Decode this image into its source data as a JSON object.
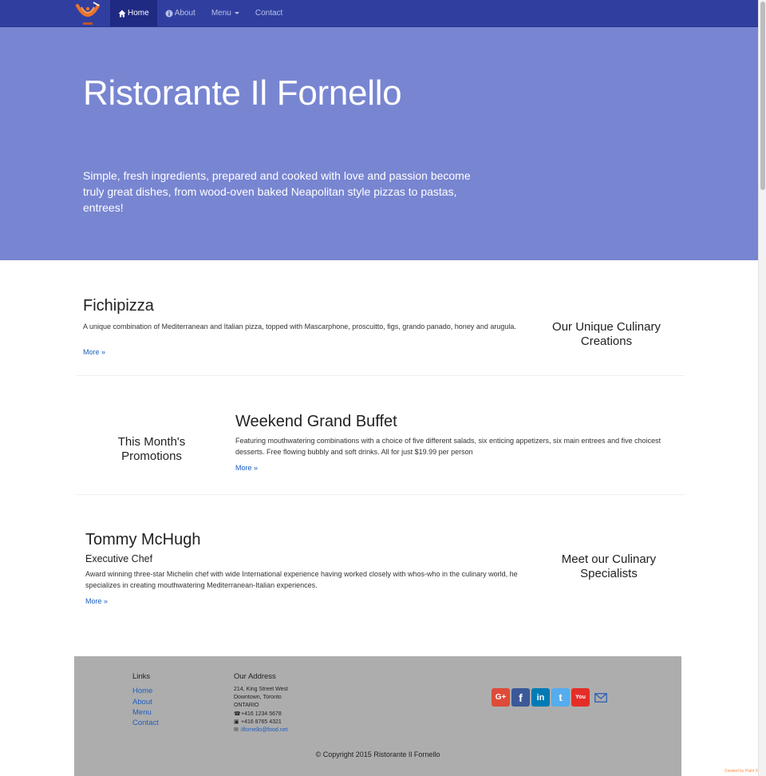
{
  "nav": {
    "items": [
      {
        "label": "Home",
        "active": true
      },
      {
        "label": "About"
      },
      {
        "label": "Menu"
      },
      {
        "label": "Contact"
      }
    ]
  },
  "hero": {
    "title": "Ristorante Il Fornello",
    "tagline": "Simple, fresh ingredients, prepared and cooked with love and passion become truly great dishes, from wood-oven baked Neapolitan style pizzas to pastas, entrees!"
  },
  "sections": [
    {
      "title": "Fichipizza",
      "text": "A unique combination of Mediterranean and Italian pizza, topped with Mascarphone, proscuitto, figs, grando panado, honey and arugula.",
      "more": "More »",
      "side": "Our Unique Culinary Creations"
    },
    {
      "title": "Weekend Grand Buffet",
      "text": "Featuring mouthwatering combinations with a choice of five different salads, six enticing appetizers, six main entrees and five choicest desserts. Free flowing bubbly and soft drinks. All for just $19.99 per person",
      "more": "More »",
      "side": "This Month's Promotions"
    },
    {
      "title": "Tommy McHugh",
      "subtitle": "Executive Chef",
      "text": "Award winning three-star Michelin chef with wide International experience having worked closely with whos-who in the culinary world, he specializes in creating mouthwatering Mediterranean-Italian experiences.",
      "more": "More »",
      "side": "Meet our Culinary Specialists"
    }
  ],
  "footer": {
    "links_heading": "Links",
    "links": [
      "Home",
      "About",
      "Menu",
      "Contact"
    ],
    "address_heading": "Our Address",
    "address_lines": [
      "214, King Street West",
      "Downtown, Toronto",
      "ONTARIO"
    ],
    "phone": "+416 1234 5678",
    "fax": "+416 8765 4321",
    "email": "ilfornello@food.net",
    "social": [
      {
        "icon": "google-plus-icon",
        "glyph": "G+",
        "color": "#dd4b39"
      },
      {
        "icon": "facebook-icon",
        "glyph": "f",
        "color": "#3b5998"
      },
      {
        "icon": "linkedin-icon",
        "glyph": "in",
        "color": "#007bb6"
      },
      {
        "icon": "twitter-icon",
        "glyph": "t",
        "color": "#55acee"
      },
      {
        "icon": "youtube-icon",
        "glyph": "You",
        "color": "#e52d27"
      }
    ],
    "copyright": "© Copyright 2015 Ristorante Il Fornello"
  },
  "credit": "Created by Paint X"
}
